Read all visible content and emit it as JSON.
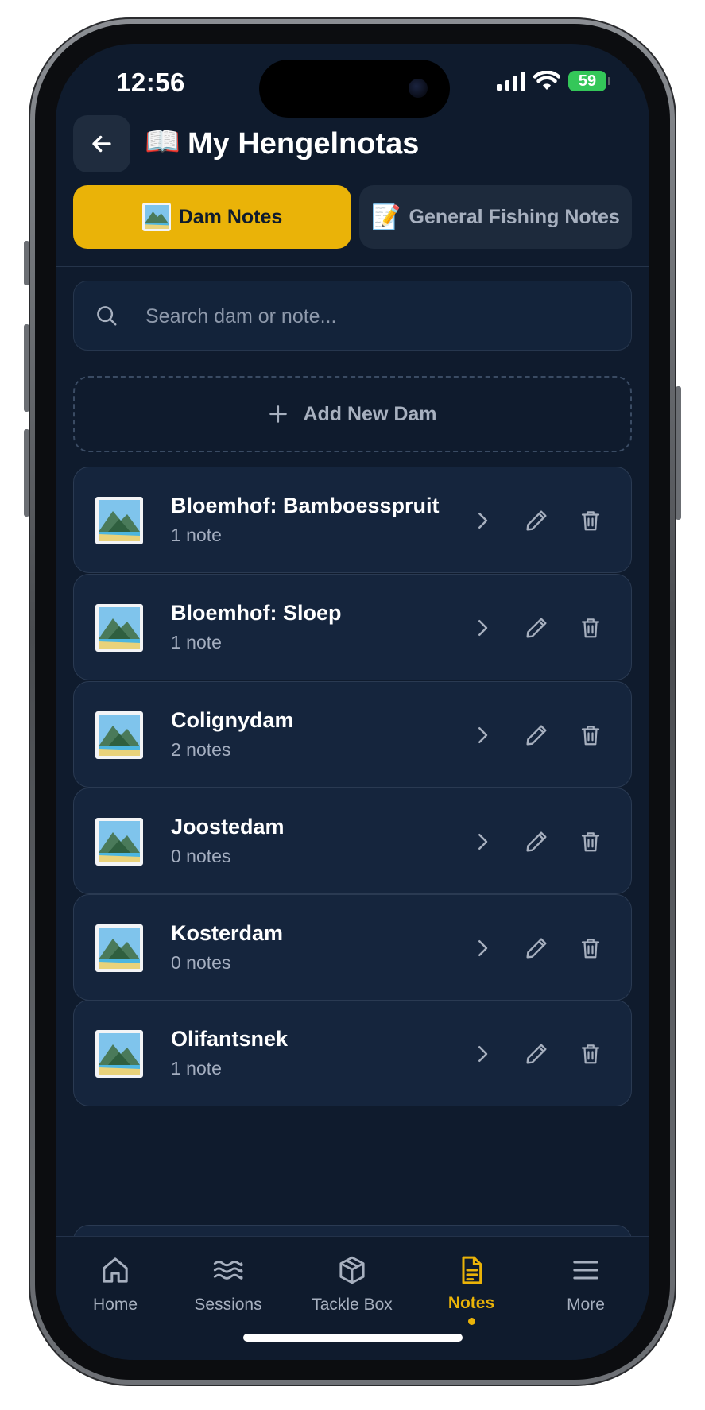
{
  "status_bar": {
    "time": "12:56",
    "battery": "59"
  },
  "header": {
    "title": "My Hengelnotas",
    "title_emoji": "📖"
  },
  "tabs": [
    {
      "label": "Dam Notes",
      "active": true
    },
    {
      "label": "General Fishing Notes",
      "emoji": "📝",
      "active": false
    }
  ],
  "search": {
    "placeholder": "Search dam or note..."
  },
  "add_dam": {
    "label": "Add New Dam"
  },
  "dams": [
    {
      "name": "Bloemhof: Bamboesspruit",
      "count": "1 note"
    },
    {
      "name": "Bloemhof: Sloep",
      "count": "1 note"
    },
    {
      "name": "Colignydam",
      "count": "2 notes"
    },
    {
      "name": "Joostedam",
      "count": "0 notes"
    },
    {
      "name": "Kosterdam",
      "count": "0 notes"
    },
    {
      "name": "Olifantsnek",
      "count": "1 note"
    }
  ],
  "bottom_nav": [
    {
      "label": "Home",
      "icon": "home-icon"
    },
    {
      "label": "Sessions",
      "icon": "waves-icon"
    },
    {
      "label": "Tackle Box",
      "icon": "box-icon"
    },
    {
      "label": "Notes",
      "icon": "document-icon",
      "active": true
    },
    {
      "label": "More",
      "icon": "menu-icon"
    }
  ],
  "colors": {
    "background": "#0f1b2d",
    "accent": "#eab308",
    "card": "#15253d"
  }
}
